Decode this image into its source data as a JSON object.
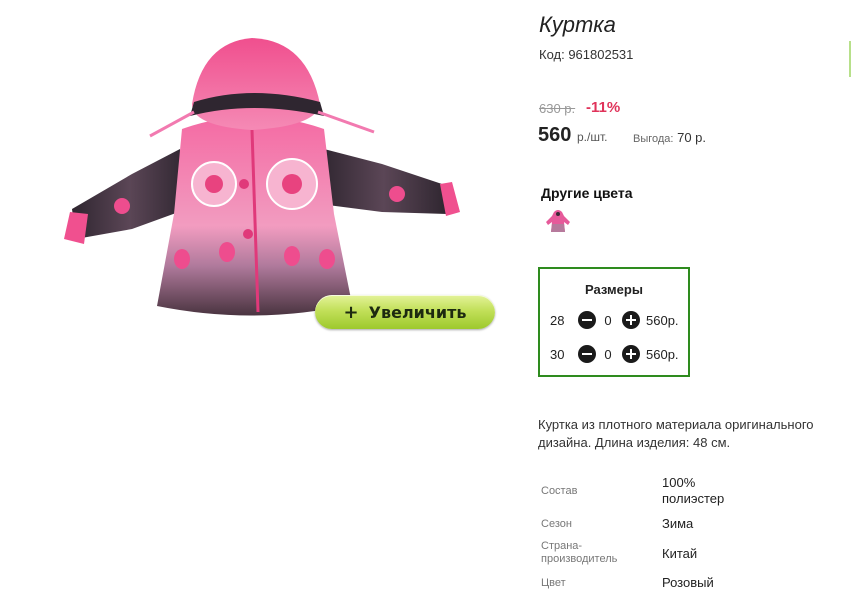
{
  "product": {
    "title": "Куртка",
    "code": "Код: 961802531",
    "old_price": "630 р.",
    "discount": "-11%",
    "price": "560",
    "price_unit": "р./шт.",
    "savings_label": "Выгода:",
    "savings_value": "70 р."
  },
  "image": {
    "zoom_plus": "+",
    "zoom_label": "Увеличить",
    "jacket_colors": {
      "main": "#ee4d8e",
      "light": "#f7a6c6",
      "dark": "#3a2a36"
    }
  },
  "other_colors": {
    "heading": "Другие цвета",
    "swatches": [
      {
        "icon": "pink-jacket-thumbnail"
      }
    ]
  },
  "sizes": {
    "heading": "Размеры",
    "rows": [
      {
        "size": "28",
        "qty": "0",
        "price": "560р."
      },
      {
        "size": "30",
        "qty": "0",
        "price": "560р."
      }
    ]
  },
  "description": "Куртка из плотного материала оригинального дизайна. Длина изделия: 48 см.",
  "specs": [
    {
      "label": "Состав",
      "value": "100% полиэстер"
    },
    {
      "label": "Сезон",
      "value": "Зима"
    },
    {
      "label": "Страна-производитель",
      "value": "Китай"
    },
    {
      "label": "Цвет",
      "value": "Розовый"
    }
  ],
  "colors": {
    "accent_green": "#2e8b1e",
    "discount_red": "#e0335a"
  }
}
